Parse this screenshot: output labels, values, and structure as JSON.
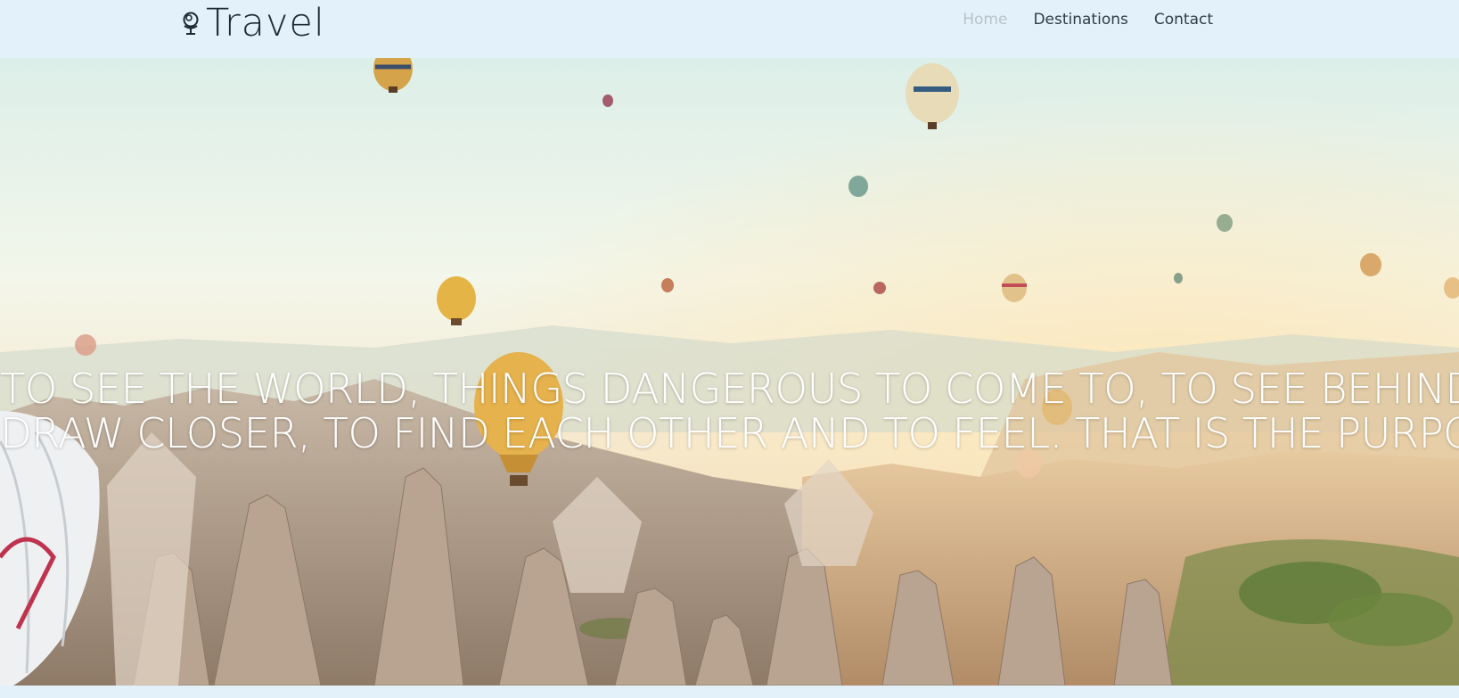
{
  "brand": {
    "name": "Travel",
    "icon": "globe-stand-icon"
  },
  "nav": {
    "items": [
      {
        "label": "Home",
        "active": true
      },
      {
        "label": "Destinations",
        "active": false
      },
      {
        "label": "Contact",
        "active": false
      }
    ]
  },
  "hero": {
    "image": "hot-air-balloons-over-rock-valley",
    "quote_line1": "TO SEE THE WORLD, THINGS DANGEROUS TO COME TO, TO SEE BEHIND WALLS,",
    "quote_line2": "DRAW CLOSER, TO FIND EACH OTHER AND TO FEEL. THAT IS THE PURPOSE OF LIFE."
  },
  "colors": {
    "header_bg": "#e3f1fa",
    "nav_text": "#2f3d46",
    "nav_active": "#b9c3c9",
    "brand_text": "#1c2a33"
  }
}
